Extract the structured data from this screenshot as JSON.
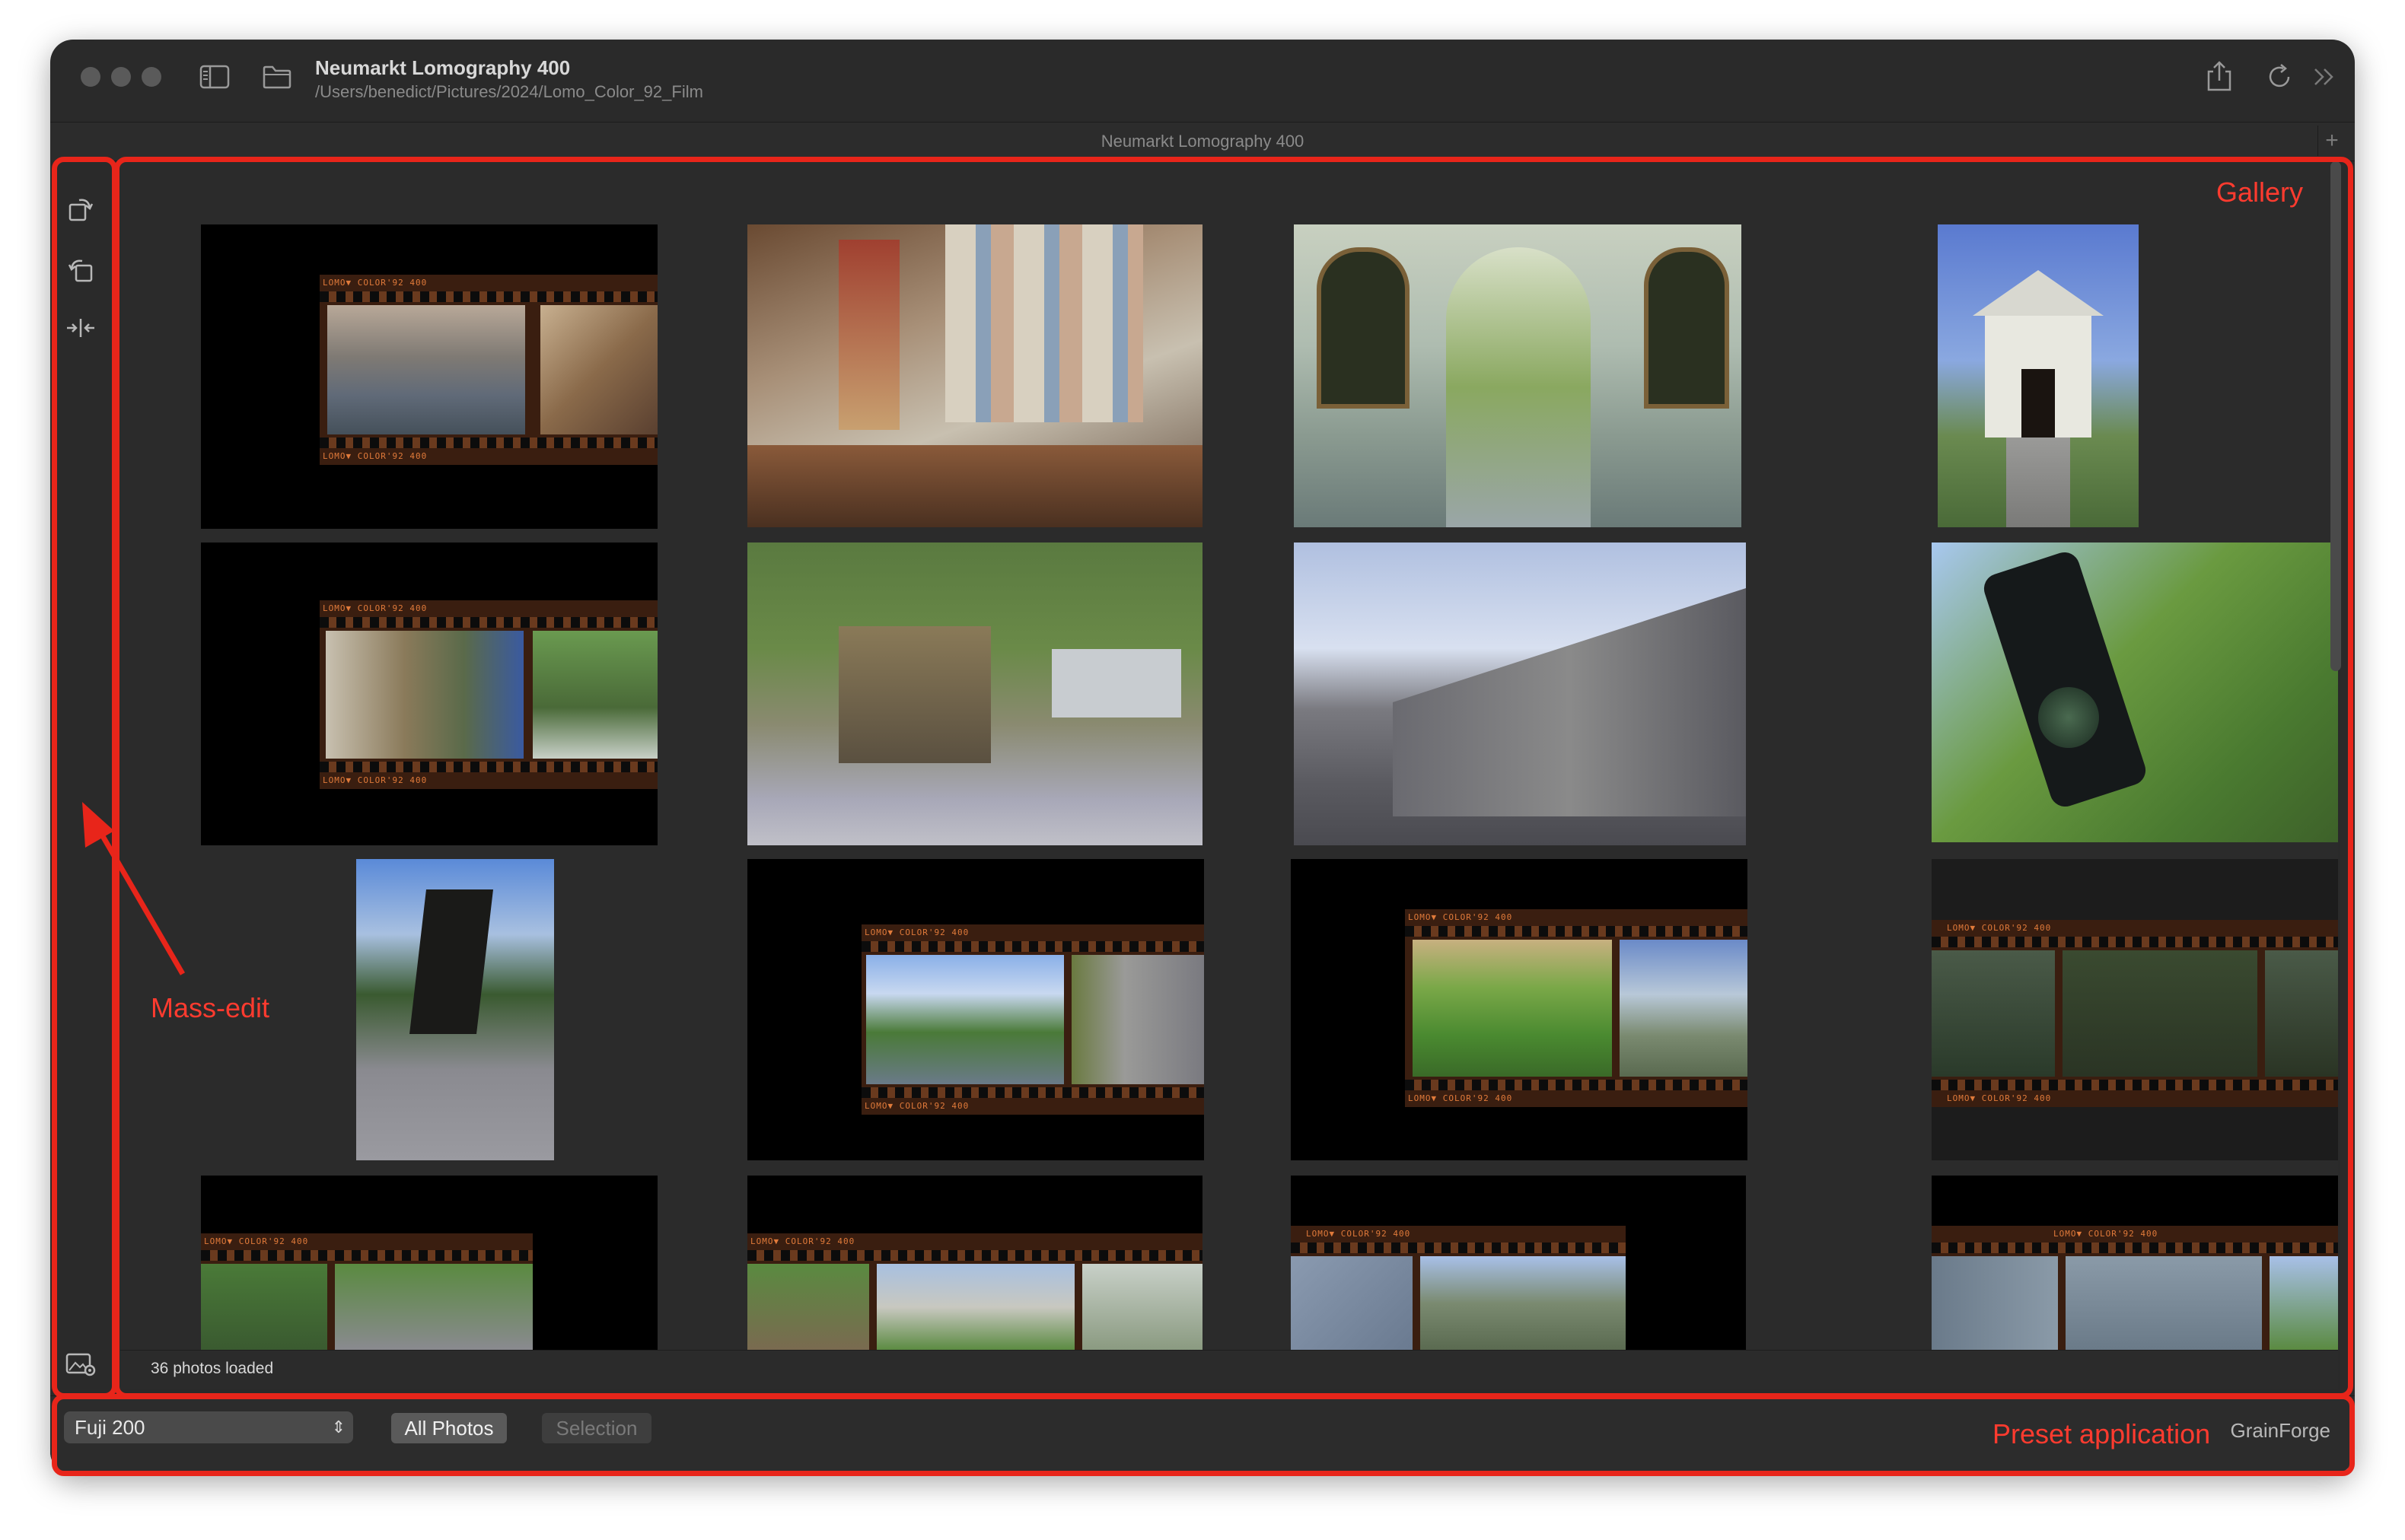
{
  "window": {
    "title": "Neumarkt Lomography 400",
    "path": "/Users/benedict/Pictures/2024/Lomo_Color_92_Film",
    "tab_title": "Neumarkt Lomography 400",
    "tab_add": "+"
  },
  "gallery": {
    "status": "36 photos loaded",
    "strip_label": "LOMO▼ COLOR'92 400",
    "close_glyph": "×"
  },
  "bottom": {
    "preset_value": "Fuji 200",
    "all_photos": "All Photos",
    "selection": "Selection",
    "brand": "GrainForge"
  },
  "annotations": {
    "gallery": "Gallery",
    "mass_edit": "Mass-edit",
    "preset_application": "Preset application"
  },
  "colors": {
    "annotation": "#e8251a",
    "window_bg": "#2a2a2a",
    "film_orange": "#e07a3a"
  }
}
